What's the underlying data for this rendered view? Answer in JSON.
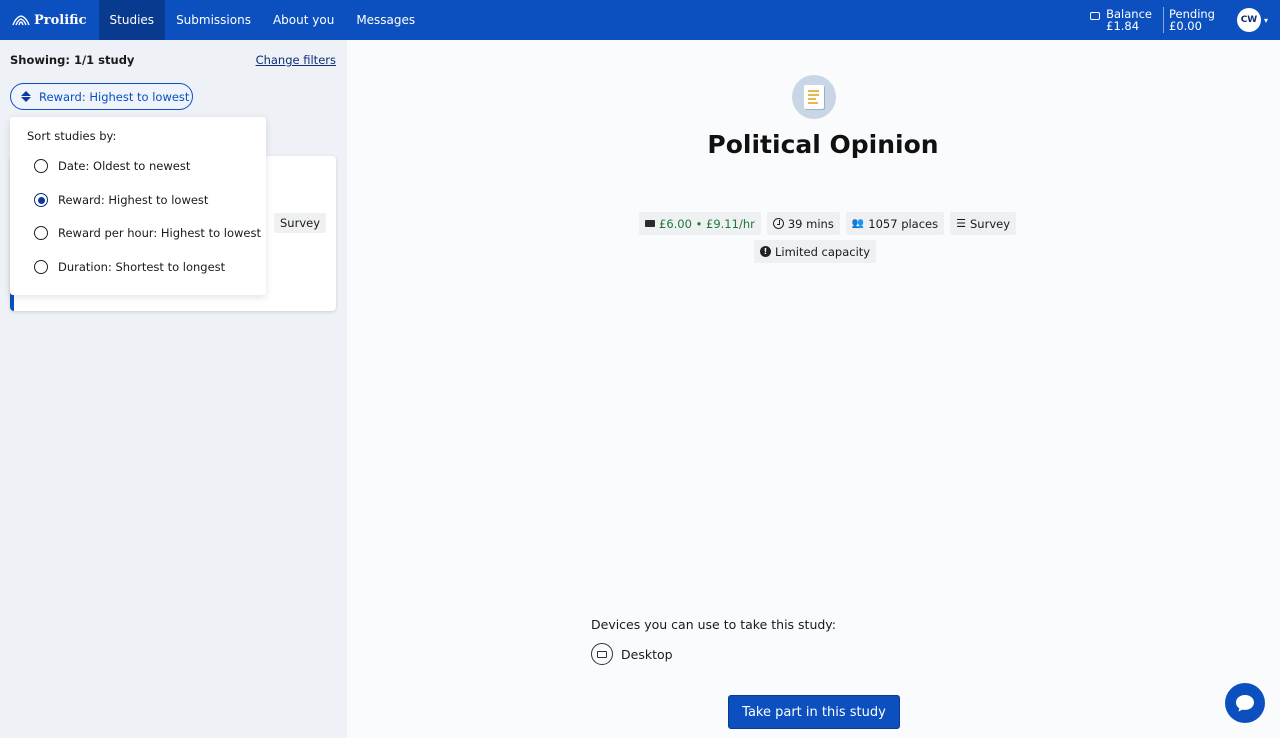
{
  "nav": {
    "brand": "Prolific",
    "tabs": [
      {
        "label": "Studies",
        "active": true
      },
      {
        "label": "Submissions"
      },
      {
        "label": "About you"
      },
      {
        "label": "Messages"
      }
    ],
    "balance_label": "Balance",
    "balance_value": "£1.84",
    "pending_label": "Pending",
    "pending_value": "£0.00",
    "avatar_initials": "CW"
  },
  "sidebar": {
    "showing": "Showing: 1/1 study",
    "change_filters": "Change filters",
    "sort_label": "Reward: Highest to lowest",
    "card_type": "Survey",
    "dropdown": {
      "title": "Sort studies by:",
      "options": [
        {
          "label": "Date: Oldest to newest",
          "checked": false
        },
        {
          "label": "Reward: Highest to lowest",
          "checked": true
        },
        {
          "label": "Reward per hour: Highest to lowest",
          "checked": false
        },
        {
          "label": "Duration: Shortest to longest",
          "checked": false
        }
      ]
    }
  },
  "main": {
    "title": "Political Opinion",
    "reward": "£6.00 • £9.11/hr",
    "duration": "39 mins",
    "places": "1057 places",
    "type": "Survey",
    "capacity": "Limited capacity",
    "devices_label": "Devices you can use to take this study:",
    "device": "Desktop",
    "cta": "Take part in this study"
  },
  "colors": {
    "primary": "#0c4fbf",
    "reward_green": "#1c7a3a"
  }
}
